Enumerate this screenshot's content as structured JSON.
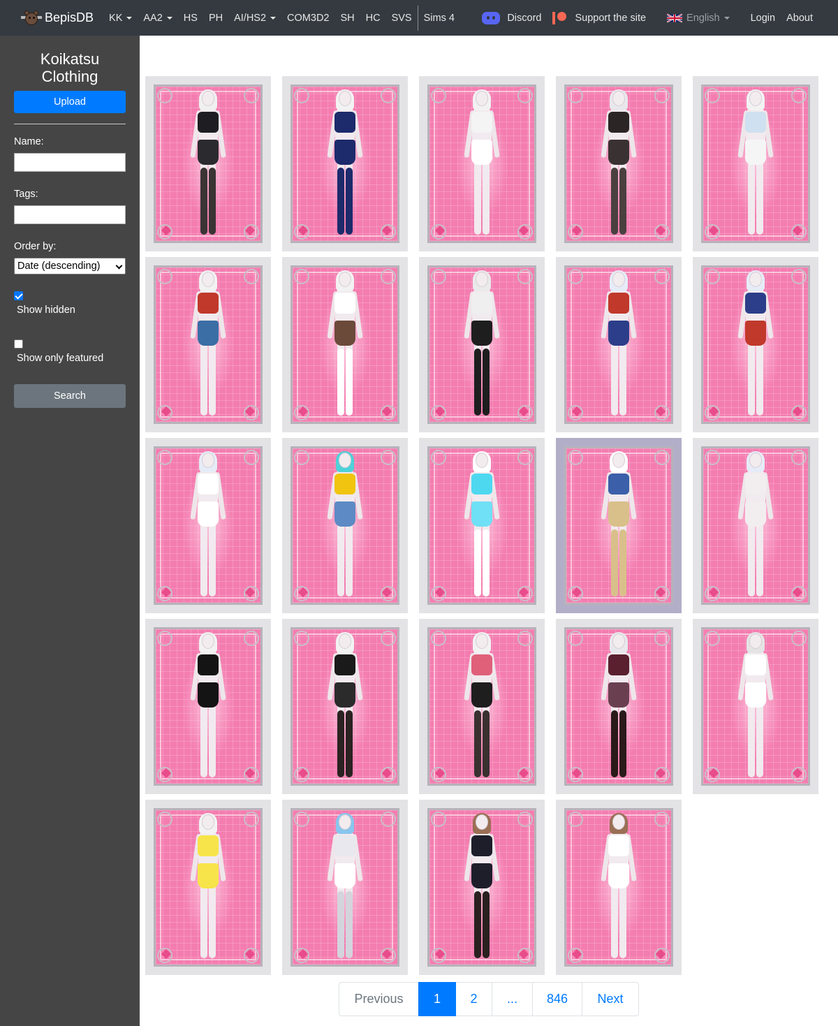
{
  "brand": {
    "name": "BepisDB"
  },
  "nav": {
    "items": [
      {
        "label": "KK",
        "dropdown": true
      },
      {
        "label": "AA2",
        "dropdown": true
      },
      {
        "label": "HS",
        "dropdown": false
      },
      {
        "label": "PH",
        "dropdown": false
      },
      {
        "label": "AI/HS2",
        "dropdown": true
      },
      {
        "label": "COM3D2",
        "dropdown": false
      },
      {
        "label": "SH",
        "dropdown": false
      },
      {
        "label": "HC",
        "dropdown": false
      },
      {
        "label": "SVS",
        "dropdown": false
      }
    ],
    "sims": "Sims 4",
    "discord": "Discord",
    "support": "Support the site",
    "language": "English",
    "login": "Login",
    "about": "About"
  },
  "sidebar": {
    "title_line1": "Koikatsu",
    "title_line2": "Clothing",
    "upload": "Upload",
    "name_label": "Name:",
    "name_value": "",
    "tags_label": "Tags:",
    "tags_value": "",
    "order_label": "Order by:",
    "order_value": "Date (descending)",
    "show_hidden_label": "Show hidden",
    "show_hidden_checked": true,
    "featured_label": "Show only featured",
    "featured_checked": false,
    "search": "Search"
  },
  "cards": [
    {
      "top": "#1e1e22",
      "bottom": "#2b2b2f",
      "legs": "#3a3434",
      "hair": "#f0f0f0",
      "highlight": false
    },
    {
      "top": "#1d2a6b",
      "bottom": "#1d2a6b",
      "legs": "#1d2a6b",
      "hair": "#f2f2f2",
      "highlight": false
    },
    {
      "top": "#f4f4f4",
      "bottom": "#ffffff",
      "legs": "",
      "hair": "#f2f2f2",
      "highlight": false
    },
    {
      "top": "#2b2525",
      "bottom": "#3a3232",
      "legs": "#4a4040",
      "hair": "#e8e8ec",
      "highlight": false
    },
    {
      "top": "#cfe0f0",
      "bottom": "#f5f5f5",
      "legs": "",
      "hair": "#f2f2f2",
      "highlight": false
    },
    {
      "top": "#c0392b",
      "bottom": "#3a6ea5",
      "legs": "",
      "hair": "#f2f2f2",
      "highlight": false
    },
    {
      "top": "#ffffff",
      "bottom": "#6b4a3a",
      "legs": "#ffffff",
      "hair": "#f2f2f2",
      "highlight": false
    },
    {
      "top": "#efefef",
      "bottom": "#1e1e1e",
      "legs": "#1e1e1e",
      "hair": "#eaeaea",
      "highlight": false
    },
    {
      "top": "#c0392b",
      "bottom": "#2c3e8a",
      "legs": "",
      "hair": "#e6ecf7",
      "highlight": false
    },
    {
      "top": "#2c3e8a",
      "bottom": "#c0392b",
      "legs": "",
      "hair": "#e6ecf7",
      "highlight": false
    },
    {
      "top": "#ffffff",
      "bottom": "#ffffff",
      "legs": "",
      "hair": "#e6ecf7",
      "highlight": false
    },
    {
      "top": "#f1c40f",
      "bottom": "#5d8ac4",
      "legs": "",
      "hair": "#4fd1d9",
      "highlight": false
    },
    {
      "top": "#4ed8f0",
      "bottom": "#6fe0f5",
      "legs": "#ffffff",
      "hair": "#ffffff",
      "highlight": false
    },
    {
      "top": "#3b5fa8",
      "bottom": "#d9c08a",
      "legs": "#d9c08a",
      "hair": "#ffffff",
      "highlight": true
    },
    {
      "top": "#f2eef0",
      "bottom": "#f2eef0",
      "legs": "",
      "hair": "#e6ecf7",
      "highlight": false
    },
    {
      "top": "#141414",
      "bottom": "#141414",
      "legs": "",
      "hair": "#f2f2f2",
      "highlight": false
    },
    {
      "top": "#1a1a1a",
      "bottom": "#2b2b2b",
      "legs": "#2b2222",
      "hair": "#f2f2f2",
      "highlight": false
    },
    {
      "top": "#e0607a",
      "bottom": "#1e1e1e",
      "legs": "#3a3030",
      "hair": "#f2f2f2",
      "highlight": false
    },
    {
      "top": "#5a2030",
      "bottom": "#6a4050",
      "legs": "#2a1a1a",
      "hair": "#e8e8ec",
      "highlight": false
    },
    {
      "top": "#ffffff",
      "bottom": "#ffffff",
      "legs": "",
      "hair": "#e4e4e4",
      "highlight": false
    },
    {
      "top": "#f7e44a",
      "bottom": "#f7e44a",
      "legs": "",
      "hair": "#f2f2f2",
      "highlight": false
    },
    {
      "top": "#e8e8ee",
      "bottom": "#ffffff",
      "legs": "#d4d4dc",
      "hair": "#88c6ee",
      "highlight": false
    },
    {
      "top": "#1e1e2a",
      "bottom": "#1e1e2a",
      "legs": "#2a2020",
      "hair": "#9a6f55",
      "highlight": false
    },
    {
      "top": "#ffffff",
      "bottom": "#ffffff",
      "legs": "",
      "hair": "#9a6f55",
      "highlight": false
    }
  ],
  "pagination": {
    "previous": "Previous",
    "pages": [
      "1",
      "2",
      "...",
      "846"
    ],
    "active": "1",
    "next": "Next"
  }
}
